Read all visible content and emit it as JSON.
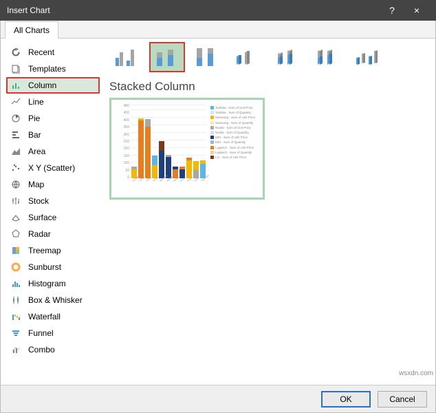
{
  "titlebar": {
    "title": "Insert Chart",
    "help": "?",
    "close": "×"
  },
  "tabs": {
    "all": "All Charts"
  },
  "sidebar": {
    "items": [
      {
        "label": "Recent"
      },
      {
        "label": "Templates"
      },
      {
        "label": "Column"
      },
      {
        "label": "Line"
      },
      {
        "label": "Pie"
      },
      {
        "label": "Bar"
      },
      {
        "label": "Area"
      },
      {
        "label": "X Y (Scatter)"
      },
      {
        "label": "Map"
      },
      {
        "label": "Stock"
      },
      {
        "label": "Surface"
      },
      {
        "label": "Radar"
      },
      {
        "label": "Treemap"
      },
      {
        "label": "Sunburst"
      },
      {
        "label": "Histogram"
      },
      {
        "label": "Box & Whisker"
      },
      {
        "label": "Waterfall"
      },
      {
        "label": "Funnel"
      },
      {
        "label": "Combo"
      }
    ]
  },
  "main": {
    "chart_title": "Stacked Column"
  },
  "footer": {
    "ok": "OK",
    "cancel": "Cancel"
  },
  "watermark": "wsxdn.com",
  "chart_data": {
    "type": "bar",
    "stacked": true,
    "title": "",
    "ylabel": "",
    "ylim": [
      0,
      480
    ],
    "yticks": [
      0,
      50,
      100,
      150,
      200,
      250,
      300,
      350,
      400,
      450,
      480
    ],
    "categories": [
      "Cooler",
      "CPU",
      "GPU",
      "HDD",
      "Monitor",
      "Motherboard",
      "Mouse",
      "PSU",
      "Ram",
      "SSD",
      "Vrg Kits"
    ],
    "series": [
      {
        "name": "Toshiba - Sum of Unit Price",
        "color": "#5BB5E8"
      },
      {
        "name": "Toshiba - Sum of Quantity",
        "color": "#C9E8F7"
      },
      {
        "name": "Samsung - Sum of Unit Price",
        "color": "#F5B800"
      },
      {
        "name": "Samsung - Sum of Quantity",
        "color": "#FCE9A8"
      },
      {
        "name": "Nvidia - Sum of Unit Price",
        "color": "#A8A8A8"
      },
      {
        "name": "Nvidia - Sum of Quantity",
        "color": "#DDDDDD"
      },
      {
        "name": "MSI - Sum of Unit Price",
        "color": "#1F3F7F"
      },
      {
        "name": "MSI - Sum of Quantity",
        "color": "#9FB4D9"
      },
      {
        "name": "Logitech - Sum of Unit Price",
        "color": "#E87D1E"
      },
      {
        "name": "Logitech - Sum of Quantity",
        "color": "#F7CBA0"
      },
      {
        "name": "LG - Sum of Unit Price",
        "color": "#7A3A1A"
      }
    ],
    "stacks": [
      [
        {
          "s": 2,
          "v": 60
        },
        {
          "s": 4,
          "v": 15
        }
      ],
      [
        {
          "s": 8,
          "v": 380
        },
        {
          "s": 2,
          "v": 15
        }
      ],
      [
        {
          "s": 8,
          "v": 340
        },
        {
          "s": 4,
          "v": 50
        }
      ],
      [
        {
          "s": 2,
          "v": 85
        },
        {
          "s": 0,
          "v": 65
        }
      ],
      [
        {
          "s": 6,
          "v": 180
        },
        {
          "s": 10,
          "v": 65
        }
      ],
      [
        {
          "s": 6,
          "v": 140
        },
        {
          "s": 4,
          "v": 15
        }
      ],
      [
        {
          "s": 8,
          "v": 60
        },
        {
          "s": 6,
          "v": 15
        }
      ],
      [
        {
          "s": 6,
          "v": 60
        },
        {
          "s": 8,
          "v": 15
        }
      ],
      [
        {
          "s": 2,
          "v": 120
        },
        {
          "s": 8,
          "v": 15
        }
      ],
      [
        {
          "s": 4,
          "v": 55
        },
        {
          "s": 2,
          "v": 60
        }
      ],
      [
        {
          "s": 0,
          "v": 95
        },
        {
          "s": 2,
          "v": 25
        }
      ]
    ]
  }
}
